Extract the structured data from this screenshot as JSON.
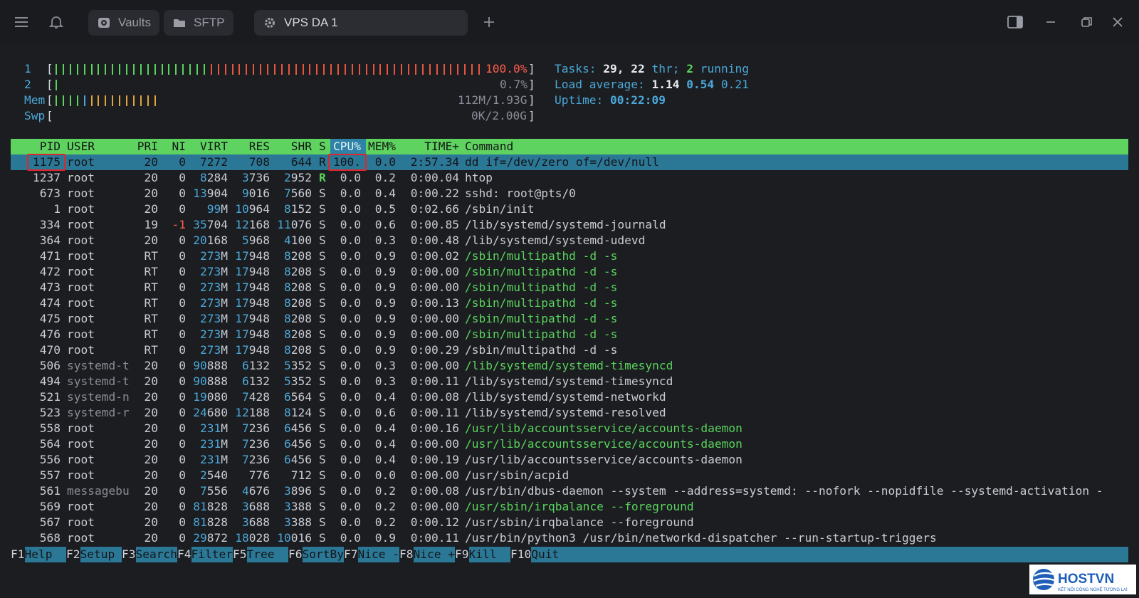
{
  "titlebar": {
    "tabs": [
      {
        "label": "Vaults",
        "icon": "vault-icon"
      },
      {
        "label": "SFTP",
        "icon": "folder-icon"
      },
      {
        "label": "VPS DA 1",
        "icon": "gear-icon"
      }
    ]
  },
  "meters": {
    "cpu1": {
      "label": "1",
      "value": "100.0%",
      "fraction": 1.0
    },
    "cpu2": {
      "label": "2",
      "value": "0.7%",
      "fraction": 0.007
    },
    "mem": {
      "label": "Mem",
      "value": "112M/1.93G"
    },
    "swp": {
      "label": "Swp",
      "value": "0K/2.00G"
    }
  },
  "summary": {
    "tasks_label": "Tasks:",
    "tasks": "29,",
    "threads": "22",
    "thr_label": "thr;",
    "running": "2",
    "running_label": "running",
    "load_label": "Load average:",
    "load1": "1.14",
    "load5": "0.54",
    "load15": "0.21",
    "uptime_label": "Uptime:",
    "uptime": "00:22:09"
  },
  "columns": [
    "PID",
    "USER",
    "PRI",
    "NI",
    "VIRT",
    "RES",
    "SHR",
    "S",
    "CPU%",
    "MEM%",
    "TIME+",
    "Command"
  ],
  "processes": [
    {
      "pid": "1175",
      "user": "root",
      "pri": "20",
      "ni": "0",
      "virt": "7272",
      "res": "708",
      "shr": "644",
      "s": "R",
      "cpu": "100.",
      "mem": "0.0",
      "time": "2:57.34",
      "cmd": "dd if=/dev/zero of=/dev/null"
    },
    {
      "pid": "1237",
      "user": "root",
      "pri": "20",
      "ni": "0",
      "virt": "8284",
      "res": "3736",
      "shr": "2952",
      "s": "R",
      "cpu": "0.0",
      "mem": "0.2",
      "time": "0:00.04",
      "cmd": "htop"
    },
    {
      "pid": "673",
      "user": "root",
      "pri": "20",
      "ni": "0",
      "virt": "13904",
      "res": "9016",
      "shr": "7560",
      "s": "S",
      "cpu": "0.0",
      "mem": "0.4",
      "time": "0:00.22",
      "cmd": "sshd: root@pts/0"
    },
    {
      "pid": "1",
      "user": "root",
      "pri": "20",
      "ni": "0",
      "virt": "99M",
      "res": "10964",
      "shr": "8152",
      "s": "S",
      "cpu": "0.0",
      "mem": "0.5",
      "time": "0:02.66",
      "cmd": "/sbin/init"
    },
    {
      "pid": "334",
      "user": "root",
      "pri": "19",
      "ni": "-1",
      "virt": "35704",
      "res": "12168",
      "shr": "11076",
      "s": "S",
      "cpu": "0.0",
      "mem": "0.6",
      "time": "0:00.85",
      "cmd": "/lib/systemd/systemd-journald"
    },
    {
      "pid": "364",
      "user": "root",
      "pri": "20",
      "ni": "0",
      "virt": "20168",
      "res": "5968",
      "shr": "4100",
      "s": "S",
      "cpu": "0.0",
      "mem": "0.3",
      "time": "0:00.48",
      "cmd": "/lib/systemd/systemd-udevd"
    },
    {
      "pid": "471",
      "user": "root",
      "pri": "RT",
      "ni": "0",
      "virt": "273M",
      "res": "17948",
      "shr": "8208",
      "s": "S",
      "cpu": "0.0",
      "mem": "0.9",
      "time": "0:00.02",
      "cmd": "/sbin/multipathd -d -s",
      "thread": true
    },
    {
      "pid": "472",
      "user": "root",
      "pri": "RT",
      "ni": "0",
      "virt": "273M",
      "res": "17948",
      "shr": "8208",
      "s": "S",
      "cpu": "0.0",
      "mem": "0.9",
      "time": "0:00.00",
      "cmd": "/sbin/multipathd -d -s",
      "thread": true
    },
    {
      "pid": "473",
      "user": "root",
      "pri": "RT",
      "ni": "0",
      "virt": "273M",
      "res": "17948",
      "shr": "8208",
      "s": "S",
      "cpu": "0.0",
      "mem": "0.9",
      "time": "0:00.00",
      "cmd": "/sbin/multipathd -d -s",
      "thread": true
    },
    {
      "pid": "474",
      "user": "root",
      "pri": "RT",
      "ni": "0",
      "virt": "273M",
      "res": "17948",
      "shr": "8208",
      "s": "S",
      "cpu": "0.0",
      "mem": "0.9",
      "time": "0:00.13",
      "cmd": "/sbin/multipathd -d -s",
      "thread": true
    },
    {
      "pid": "475",
      "user": "root",
      "pri": "RT",
      "ni": "0",
      "virt": "273M",
      "res": "17948",
      "shr": "8208",
      "s": "S",
      "cpu": "0.0",
      "mem": "0.9",
      "time": "0:00.00",
      "cmd": "/sbin/multipathd -d -s",
      "thread": true
    },
    {
      "pid": "476",
      "user": "root",
      "pri": "RT",
      "ni": "0",
      "virt": "273M",
      "res": "17948",
      "shr": "8208",
      "s": "S",
      "cpu": "0.0",
      "mem": "0.9",
      "time": "0:00.00",
      "cmd": "/sbin/multipathd -d -s",
      "thread": true
    },
    {
      "pid": "470",
      "user": "root",
      "pri": "RT",
      "ni": "0",
      "virt": "273M",
      "res": "17948",
      "shr": "8208",
      "s": "S",
      "cpu": "0.0",
      "mem": "0.9",
      "time": "0:00.29",
      "cmd": "/sbin/multipathd -d -s"
    },
    {
      "pid": "506",
      "user": "systemd-t",
      "pri": "20",
      "ni": "0",
      "virt": "90888",
      "res": "6132",
      "shr": "5352",
      "s": "S",
      "cpu": "0.0",
      "mem": "0.3",
      "time": "0:00.00",
      "cmd": "/lib/systemd/systemd-timesyncd",
      "thread": true,
      "sysuser": true
    },
    {
      "pid": "494",
      "user": "systemd-t",
      "pri": "20",
      "ni": "0",
      "virt": "90888",
      "res": "6132",
      "shr": "5352",
      "s": "S",
      "cpu": "0.0",
      "mem": "0.3",
      "time": "0:00.11",
      "cmd": "/lib/systemd/systemd-timesyncd",
      "sysuser": true
    },
    {
      "pid": "521",
      "user": "systemd-n",
      "pri": "20",
      "ni": "0",
      "virt": "19080",
      "res": "7428",
      "shr": "6564",
      "s": "S",
      "cpu": "0.0",
      "mem": "0.4",
      "time": "0:00.08",
      "cmd": "/lib/systemd/systemd-networkd",
      "sysuser": true
    },
    {
      "pid": "523",
      "user": "systemd-r",
      "pri": "20",
      "ni": "0",
      "virt": "24680",
      "res": "12188",
      "shr": "8124",
      "s": "S",
      "cpu": "0.0",
      "mem": "0.6",
      "time": "0:00.11",
      "cmd": "/lib/systemd/systemd-resolved",
      "sysuser": true
    },
    {
      "pid": "558",
      "user": "root",
      "pri": "20",
      "ni": "0",
      "virt": "231M",
      "res": "7236",
      "shr": "6456",
      "s": "S",
      "cpu": "0.0",
      "mem": "0.4",
      "time": "0:00.16",
      "cmd": "/usr/lib/accountsservice/accounts-daemon",
      "thread": true
    },
    {
      "pid": "564",
      "user": "root",
      "pri": "20",
      "ni": "0",
      "virt": "231M",
      "res": "7236",
      "shr": "6456",
      "s": "S",
      "cpu": "0.0",
      "mem": "0.4",
      "time": "0:00.00",
      "cmd": "/usr/lib/accountsservice/accounts-daemon",
      "thread": true
    },
    {
      "pid": "556",
      "user": "root",
      "pri": "20",
      "ni": "0",
      "virt": "231M",
      "res": "7236",
      "shr": "6456",
      "s": "S",
      "cpu": "0.0",
      "mem": "0.4",
      "time": "0:00.19",
      "cmd": "/usr/lib/accountsservice/accounts-daemon"
    },
    {
      "pid": "557",
      "user": "root",
      "pri": "20",
      "ni": "0",
      "virt": "2540",
      "res": "776",
      "shr": "712",
      "s": "S",
      "cpu": "0.0",
      "mem": "0.0",
      "time": "0:00.00",
      "cmd": "/usr/sbin/acpid"
    },
    {
      "pid": "561",
      "user": "messagebu",
      "pri": "20",
      "ni": "0",
      "virt": "7556",
      "res": "4676",
      "shr": "3896",
      "s": "S",
      "cpu": "0.0",
      "mem": "0.2",
      "time": "0:00.08",
      "cmd": "/usr/bin/dbus-daemon --system --address=systemd: --nofork --nopidfile --systemd-activation -",
      "sysuser": true
    },
    {
      "pid": "569",
      "user": "root",
      "pri": "20",
      "ni": "0",
      "virt": "81828",
      "res": "3688",
      "shr": "3388",
      "s": "S",
      "cpu": "0.0",
      "mem": "0.2",
      "time": "0:00.00",
      "cmd": "/usr/sbin/irqbalance --foreground",
      "thread": true
    },
    {
      "pid": "567",
      "user": "root",
      "pri": "20",
      "ni": "0",
      "virt": "81828",
      "res": "3688",
      "shr": "3388",
      "s": "S",
      "cpu": "0.0",
      "mem": "0.2",
      "time": "0:00.12",
      "cmd": "/usr/sbin/irqbalance --foreground"
    },
    {
      "pid": "568",
      "user": "root",
      "pri": "20",
      "ni": "0",
      "virt": "29872",
      "res": "18028",
      "shr": "10016",
      "s": "S",
      "cpu": "0.0",
      "mem": "0.9",
      "time": "0:00.11",
      "cmd": "/usr/bin/python3 /usr/bin/networkd-dispatcher --run-startup-triggers"
    }
  ],
  "function_keys": [
    {
      "key": "F1",
      "label": "Help"
    },
    {
      "key": "F2",
      "label": "Setup"
    },
    {
      "key": "F3",
      "label": "Search"
    },
    {
      "key": "F4",
      "label": "Filter"
    },
    {
      "key": "F5",
      "label": "Tree"
    },
    {
      "key": "F6",
      "label": "SortBy"
    },
    {
      "key": "F7",
      "label": "Nice -"
    },
    {
      "key": "F8",
      "label": "Nice +"
    },
    {
      "key": "F9",
      "label": "Kill"
    },
    {
      "key": "F10",
      "label": "Quit"
    }
  ],
  "colors": {
    "header_bg": "#5fd35f",
    "selected_bg": "#2b7796",
    "thread_cmd": "#59d35c",
    "highlight_box": "#e0262a"
  },
  "logo": {
    "name": "HOSTVN",
    "tagline": "KẾT NỐI CÔNG NGHỆ TƯƠNG LAI"
  }
}
